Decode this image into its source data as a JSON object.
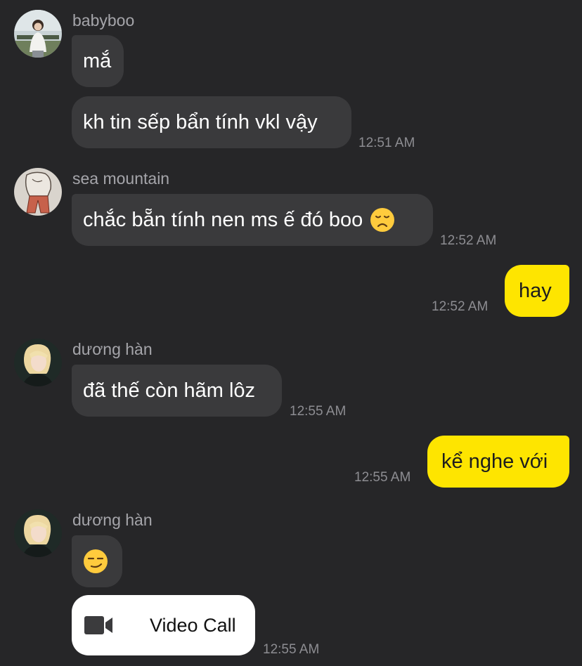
{
  "messages": [
    {
      "sender": "babyboo",
      "avatar_icon": "woman-outdoors-avatar",
      "bubbles": [
        {
          "text": "mắ"
        },
        {
          "text": "kh tin sếp bẩn tính vkl vậy",
          "time": "12:51 AM"
        }
      ]
    },
    {
      "sender": "sea mountain",
      "avatar_icon": "sketch-figure-avatar",
      "bubbles": [
        {
          "text": "chắc bẵn tính nen ms ế đó boo",
          "emoji": "disappointed-face-emoji",
          "time": "12:52 AM"
        }
      ]
    },
    {
      "mine": true,
      "bubbles": [
        {
          "text": "hay",
          "time": "12:52 AM"
        }
      ]
    },
    {
      "sender": "dương hàn",
      "avatar_icon": "blonde-person-avatar",
      "bubbles": [
        {
          "text": "đã thế còn hãm lôz",
          "time": "12:55 AM"
        }
      ]
    },
    {
      "mine": true,
      "bubbles": [
        {
          "text": "kể nghe với",
          "time": "12:55 AM"
        }
      ]
    },
    {
      "sender": "dương hàn",
      "avatar_icon": "blonde-person-avatar",
      "bubbles": [
        {
          "emoji": "smirking-face-emoji"
        },
        {
          "type": "video_call",
          "label": "Video Call",
          "icon": "video-camera-icon",
          "time": "12:55 AM"
        }
      ]
    }
  ],
  "colors": {
    "background": "#262628",
    "incoming_bubble": "#3a3a3c",
    "outgoing_bubble": "#fee500",
    "timestamp": "#8d8d92",
    "sender_name": "#a5a5aa"
  }
}
